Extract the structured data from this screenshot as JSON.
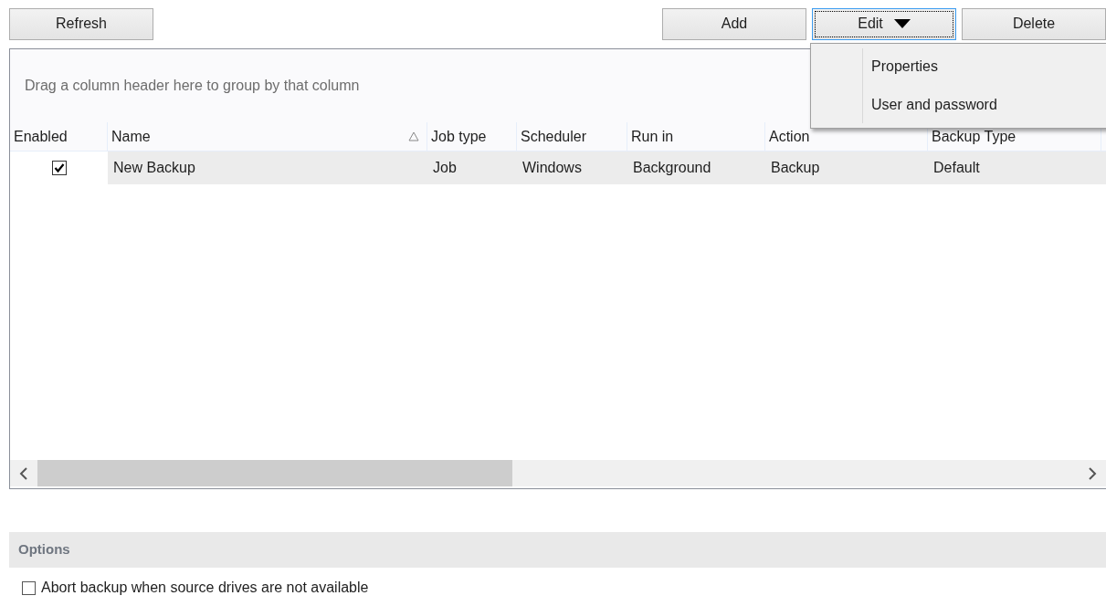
{
  "toolbar": {
    "left": [
      {
        "label": "Refresh",
        "focused": false
      }
    ],
    "right": [
      {
        "label": "Add",
        "focused": false,
        "dropdown": false
      },
      {
        "label": "Edit",
        "focused": true,
        "dropdown": true
      },
      {
        "label": "Delete",
        "focused": false,
        "dropdown": false
      }
    ]
  },
  "grid": {
    "group_hint": "Drag a column header here to group by that column",
    "columns": [
      {
        "label": "Enabled",
        "sorted": false
      },
      {
        "label": "Name",
        "sorted": true
      },
      {
        "label": "Job type",
        "sorted": false
      },
      {
        "label": "Scheduler",
        "sorted": false
      },
      {
        "label": "Run in",
        "sorted": false
      },
      {
        "label": "Action",
        "sorted": false
      },
      {
        "label": "Backup Type",
        "sorted": false
      }
    ],
    "rows": [
      {
        "cells": [
          {
            "kind": "checkbox",
            "checked": true
          },
          {
            "kind": "text",
            "text": "New Backup"
          },
          {
            "kind": "text",
            "text": "Job"
          },
          {
            "kind": "text",
            "text": "Windows"
          },
          {
            "kind": "text",
            "text": "Background"
          },
          {
            "kind": "text",
            "text": "Backup"
          },
          {
            "kind": "text",
            "text": "Default"
          }
        ]
      }
    ]
  },
  "menu": {
    "items": [
      "Properties",
      "User and password"
    ]
  },
  "options": {
    "title": "Options",
    "items": [
      {
        "label": "Abort backup when source drives are not available",
        "checked": false
      }
    ]
  }
}
